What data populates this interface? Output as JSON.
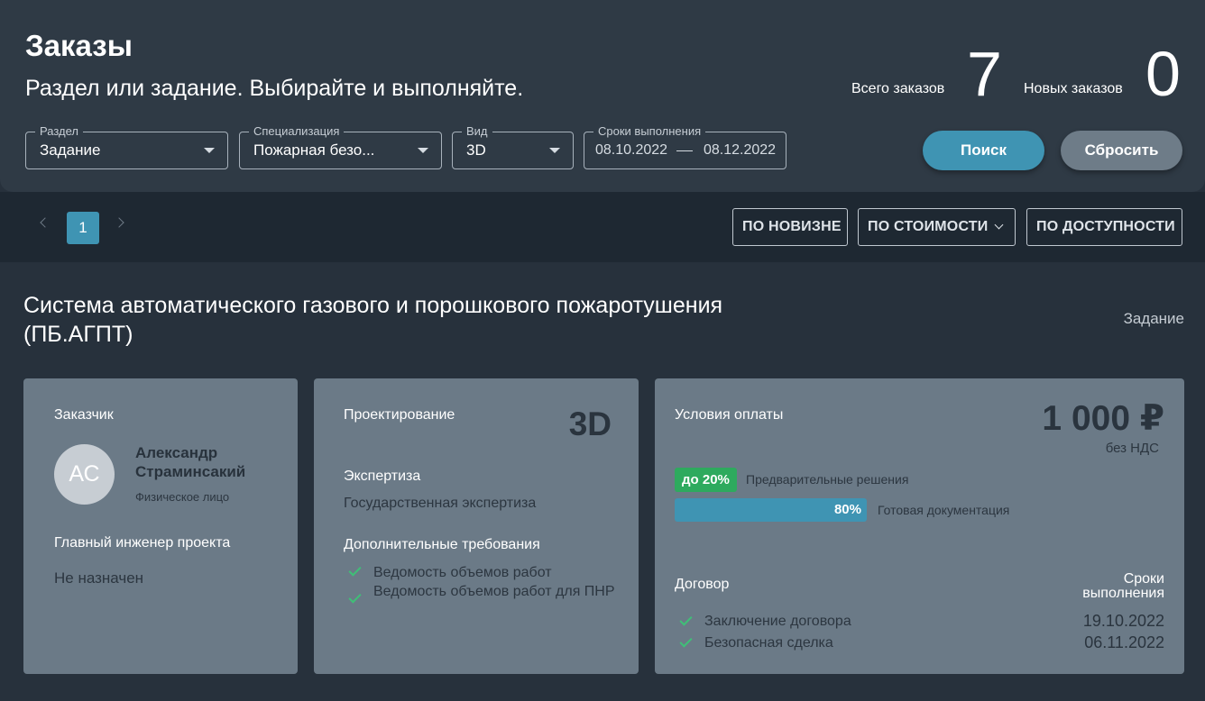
{
  "header": {
    "title": "Заказы",
    "subtitle": "Раздел или задание. Выбирайте и выполняйте.",
    "total_label": "Всего заказов",
    "total_value": "7",
    "new_label": "Новых заказов",
    "new_value": "0"
  },
  "filters": {
    "section": {
      "label": "Раздел",
      "value": "Задание"
    },
    "specialization": {
      "label": "Специализация",
      "value": "Пожарная безо..."
    },
    "kind": {
      "label": "Вид",
      "value": "3D"
    },
    "deadline": {
      "label": "Сроки выполнения",
      "from": "08.10.2022",
      "to": "08.12.2022"
    },
    "search_label": "Поиск",
    "reset_label": "Сбросить"
  },
  "pagination": {
    "current": "1"
  },
  "sort": {
    "newest": "ПО НОВИЗНЕ",
    "price": "ПО СТОИМОСТИ",
    "availability": "ПО ДОСТУПНОСТИ"
  },
  "order": {
    "title": "Система автоматического газового и порошкового пожаротушения (ПБ.АГПТ)",
    "type": "Задание",
    "customer": {
      "label": "Заказчик",
      "initials": "АС",
      "name": "Александр Страминсакий",
      "type": "Физическое лицо"
    },
    "chief_engineer": {
      "label": "Главный инженер проекта",
      "value": "Не назначен"
    },
    "design": {
      "label": "Проектирование",
      "kind": "3D",
      "expertise_label": "Экспертиза",
      "expertise_value": "Государственная экспертиза",
      "extra_label": "Дополнительные требования",
      "extra_items": [
        "Ведомость объемов работ",
        "Ведомость объемов работ для ПНР"
      ]
    },
    "payment": {
      "label": "Условия оплаты",
      "price": "1 000 ₽",
      "vat": "без НДС",
      "prepay_badge": "до 20%",
      "prepay_text": "Предварительные решения",
      "final_percent": 80,
      "final_badge": "80%",
      "final_text": "Готовая документация",
      "contract_label": "Договор",
      "deadline_label": "Сроки выполнения",
      "contract_items": [
        {
          "name": "Заключение договора",
          "date": "19.10.2022"
        },
        {
          "name": "Безопасная сделка",
          "date": "06.11.2022"
        }
      ]
    }
  },
  "colors": {
    "accent": "#3f94b3",
    "success": "#2eaa5e",
    "card_bg": "#6b7a87",
    "header_bg": "#2f3a45"
  }
}
